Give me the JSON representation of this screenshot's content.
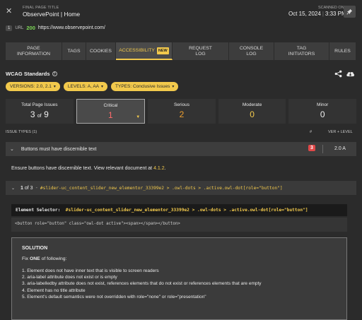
{
  "header": {
    "final_label": "FINAL PAGE TITLE",
    "page_title": "ObservePoint | Home",
    "scanned_label": "SCANNED ON",
    "scanned_date": "Oct 15, 2024",
    "scanned_time": "3:33 PM"
  },
  "url": {
    "index": "1",
    "label": "URL",
    "status": "200",
    "value": "https://www.observepoint.com/"
  },
  "tabs": [
    {
      "label": "PAGE INFORMATION",
      "active": false
    },
    {
      "label": "TAGS",
      "active": false
    },
    {
      "label": "COOKIES",
      "active": false
    },
    {
      "label": "ACCESSIBILITY",
      "active": true,
      "badge": "NEW"
    },
    {
      "label": "REQUEST LOG",
      "active": false
    },
    {
      "label": "CONSOLE LOG",
      "active": false
    },
    {
      "label": "TAG INITIATORS",
      "active": false
    },
    {
      "label": "RULES",
      "active": false
    }
  ],
  "wcag": {
    "title": "WCAG Standards",
    "filters": [
      "VERSIONS: 2.0, 2.1",
      "LEVELS: A, AA",
      "TYPES: Conclusive Issues"
    ]
  },
  "stats": [
    {
      "label": "Total Page Issues",
      "value": "3",
      "of": "of",
      "total": "9"
    },
    {
      "label": "Critical",
      "value": "1"
    },
    {
      "label": "Serious",
      "value": "2"
    },
    {
      "label": "Moderate",
      "value": "0"
    },
    {
      "label": "Minor",
      "value": "0"
    }
  ],
  "issues": {
    "header": "ISSUE TYPES (1)",
    "col_hash": "#",
    "col_ver": "VER + LEVEL",
    "row": {
      "name": "Buttons must have discernible text",
      "count": "3",
      "level": "2.0 A"
    },
    "description": "Ensure buttons have discernible text. View relevant document at",
    "doc_link": "4.1.2",
    "pager": "1",
    "pager_of": "of 3",
    "selector": "#slider-uc_content_slider_new_elementor_33399e2 > .owl-dots > .active.owl-dot[role=\"button\"]",
    "element_label": "Element Selector:",
    "element_selector": "#slider-uc_content_slider_new_elementor_33399e2 > .owl-dots > .active.owl-dot[role=\"button\"]",
    "html": "<button role=\"button\" class=\"owl-dot active\"><span></span></button>"
  },
  "solution": {
    "title": "SOLUTION",
    "fix_prefix": "Fix",
    "fix_bold": "ONE",
    "fix_suffix": "of following:",
    "items": [
      "1. Element does not have inner text that is visible to screen readers",
      "2. aria-label attribute does not exist or is empty",
      "3. aria-labelledby attribute does not exist, references elements that do not exist or references elements that are empty",
      "4. Element has no title attribute",
      "5. Element's default semantics were not overridden with role=\"none\" or role=\"presentation\""
    ]
  }
}
